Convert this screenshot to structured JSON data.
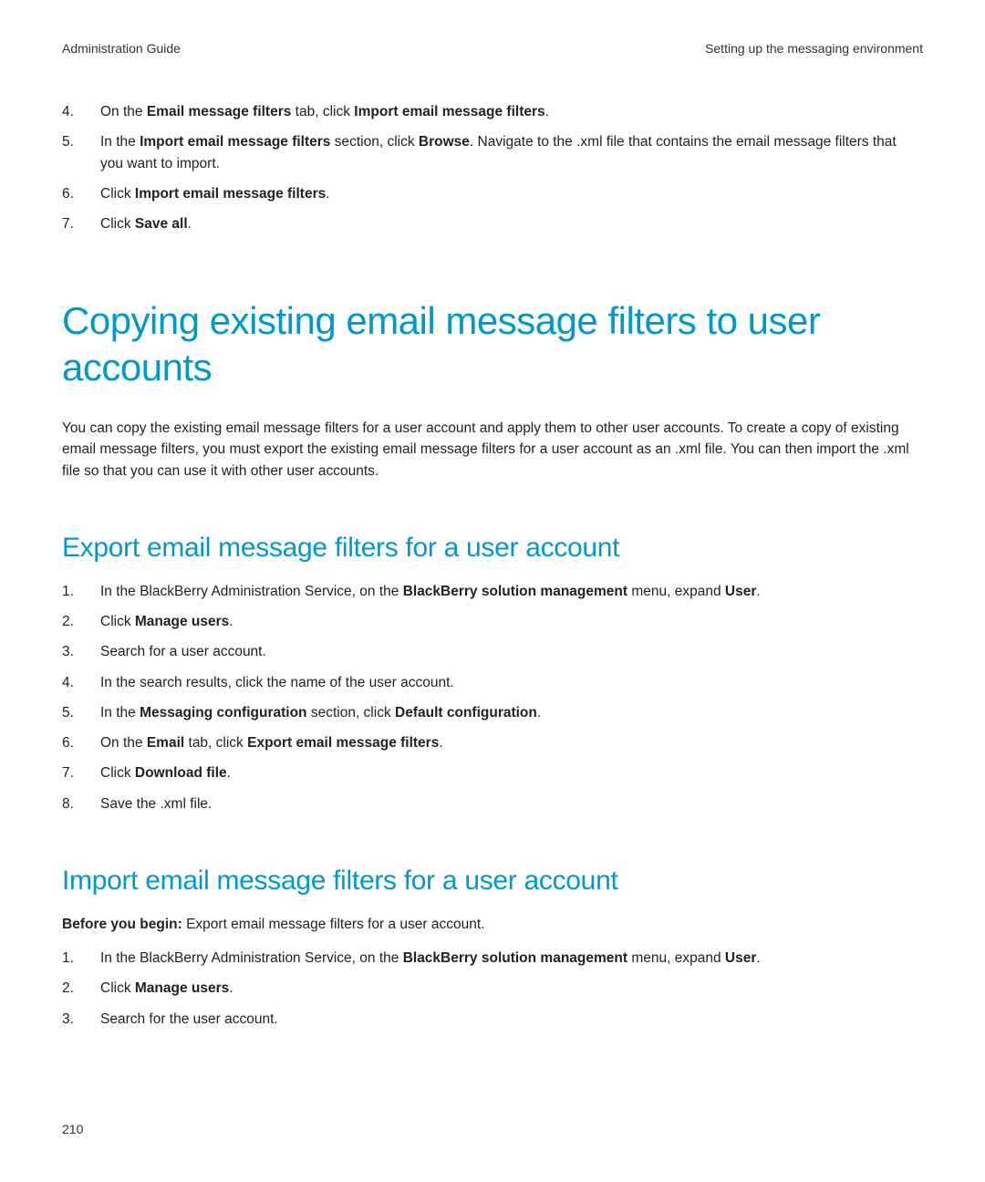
{
  "header": {
    "left": "Administration Guide",
    "right": "Setting up the messaging environment"
  },
  "topSteps": [
    {
      "num": "4.",
      "segments": [
        {
          "t": "On the ",
          "b": false
        },
        {
          "t": "Email message filters",
          "b": true
        },
        {
          "t": " tab, click ",
          "b": false
        },
        {
          "t": "Import email message filters",
          "b": true
        },
        {
          "t": ".",
          "b": false
        }
      ]
    },
    {
      "num": "5.",
      "segments": [
        {
          "t": "In the ",
          "b": false
        },
        {
          "t": "Import email message filters",
          "b": true
        },
        {
          "t": " section, click ",
          "b": false
        },
        {
          "t": "Browse",
          "b": true
        },
        {
          "t": ". Navigate to the .xml file that contains the email message filters that you want to import.",
          "b": false
        }
      ]
    },
    {
      "num": "6.",
      "segments": [
        {
          "t": "Click ",
          "b": false
        },
        {
          "t": "Import email message filters",
          "b": true
        },
        {
          "t": ".",
          "b": false
        }
      ]
    },
    {
      "num": "7.",
      "segments": [
        {
          "t": "Click ",
          "b": false
        },
        {
          "t": "Save all",
          "b": true
        },
        {
          "t": ".",
          "b": false
        }
      ]
    }
  ],
  "h1": "Copying existing email message filters to user accounts",
  "intro": "You can copy the existing email message filters for a user account and apply them to other user accounts. To create a copy of existing email message filters, you must export the existing email message filters for a user account as an .xml file. You can then import the .xml file so that you can use it with other user accounts.",
  "exportSection": {
    "title": "Export email message filters for a user account",
    "steps": [
      {
        "num": "1.",
        "segments": [
          {
            "t": "In the BlackBerry Administration Service, on the ",
            "b": false
          },
          {
            "t": "BlackBerry solution management",
            "b": true
          },
          {
            "t": " menu, expand ",
            "b": false
          },
          {
            "t": "User",
            "b": true
          },
          {
            "t": ".",
            "b": false
          }
        ]
      },
      {
        "num": "2.",
        "segments": [
          {
            "t": "Click ",
            "b": false
          },
          {
            "t": "Manage users",
            "b": true
          },
          {
            "t": ".",
            "b": false
          }
        ]
      },
      {
        "num": "3.",
        "segments": [
          {
            "t": "Search for a user account.",
            "b": false
          }
        ]
      },
      {
        "num": "4.",
        "segments": [
          {
            "t": "In the search results, click the name of the user account.",
            "b": false
          }
        ]
      },
      {
        "num": "5.",
        "segments": [
          {
            "t": "In the ",
            "b": false
          },
          {
            "t": "Messaging configuration",
            "b": true
          },
          {
            "t": " section, click ",
            "b": false
          },
          {
            "t": "Default configuration",
            "b": true
          },
          {
            "t": ".",
            "b": false
          }
        ]
      },
      {
        "num": "6.",
        "segments": [
          {
            "t": "On the ",
            "b": false
          },
          {
            "t": "Email",
            "b": true
          },
          {
            "t": " tab, click ",
            "b": false
          },
          {
            "t": "Export email message filters",
            "b": true
          },
          {
            "t": ".",
            "b": false
          }
        ]
      },
      {
        "num": "7.",
        "segments": [
          {
            "t": "Click ",
            "b": false
          },
          {
            "t": "Download file",
            "b": true
          },
          {
            "t": ".",
            "b": false
          }
        ]
      },
      {
        "num": "8.",
        "segments": [
          {
            "t": "Save the .xml file.",
            "b": false
          }
        ]
      }
    ]
  },
  "importSection": {
    "title": "Import email message filters for a user account",
    "beforeLabel": "Before you begin:",
    "beforeText": " Export email message filters for a user account.",
    "steps": [
      {
        "num": "1.",
        "segments": [
          {
            "t": "In the BlackBerry Administration Service, on the ",
            "b": false
          },
          {
            "t": "BlackBerry solution management",
            "b": true
          },
          {
            "t": " menu, expand ",
            "b": false
          },
          {
            "t": "User",
            "b": true
          },
          {
            "t": ".",
            "b": false
          }
        ]
      },
      {
        "num": "2.",
        "segments": [
          {
            "t": "Click ",
            "b": false
          },
          {
            "t": "Manage users",
            "b": true
          },
          {
            "t": ".",
            "b": false
          }
        ]
      },
      {
        "num": "3.",
        "segments": [
          {
            "t": "Search for the user account.",
            "b": false
          }
        ]
      }
    ]
  },
  "pageNumber": "210"
}
